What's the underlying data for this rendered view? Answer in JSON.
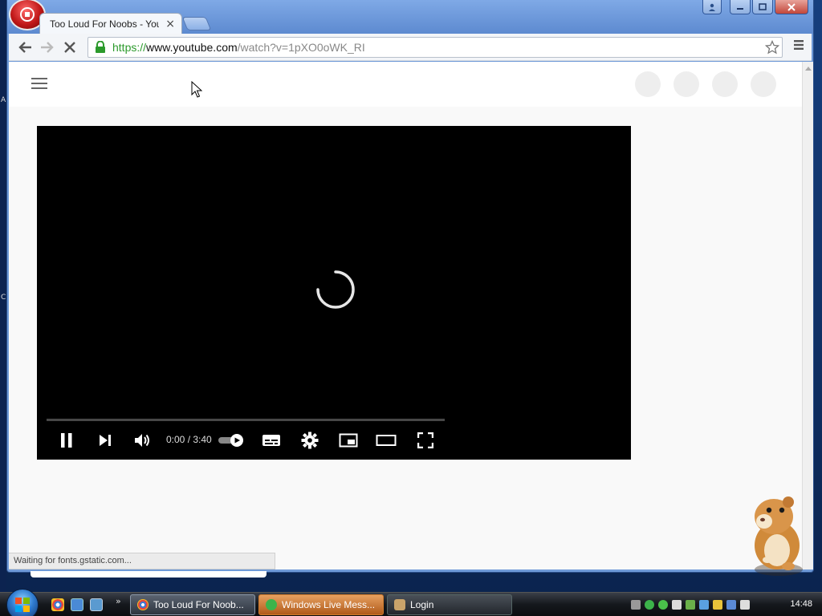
{
  "window": {
    "tab_title": "Too Loud For Noobs - You",
    "url_scheme": "https://",
    "url_host": "www.youtube.com",
    "url_path": "/watch?v=1pXO0oWK_RI"
  },
  "player": {
    "time": "0:00 / 3:40",
    "state": "loading"
  },
  "status": {
    "text": "Waiting for fonts.gstatic.com..."
  },
  "side_strip": {
    "chars": [
      "A",
      "C"
    ]
  },
  "taskbar": {
    "items": [
      {
        "label": "Too Loud For Noob...",
        "icon": "chrome-icon"
      },
      {
        "label": "Windows Live Mess...",
        "icon": "messenger-icon"
      },
      {
        "label": "Login",
        "icon": "login-icon"
      }
    ],
    "clock": "14:48",
    "quicklaunch_chevron": "»"
  },
  "colors": {
    "url_green": "#2c9a2c",
    "accent_orange": "#d07a2a",
    "player_bg": "#000000"
  }
}
